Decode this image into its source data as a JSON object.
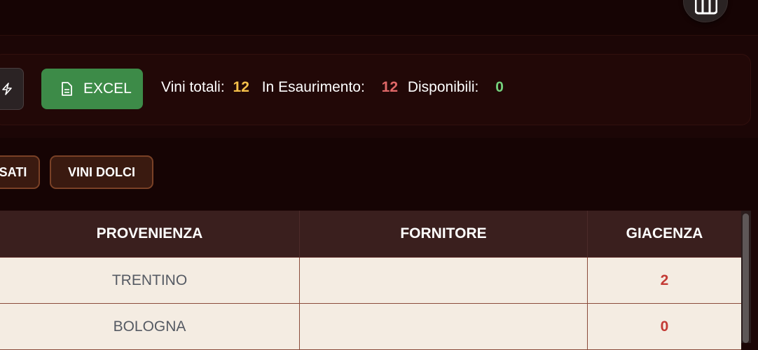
{
  "header": {
    "avatar_icon": "table-grid-icon"
  },
  "toolbar": {
    "icon_button": "bolt-icon",
    "excel_label": "EXCEL",
    "excel_icon": "document-icon",
    "accent_excel": "#3d8b48"
  },
  "stats": {
    "total_label": "Vini totali:",
    "total_value": "12",
    "low_label": "In Esaurimento:",
    "low_value": "12",
    "available_label": "Disponibili:",
    "available_value": "0"
  },
  "filters": [
    {
      "label": "SATI"
    },
    {
      "label": "VINI DOLCI"
    }
  ],
  "table": {
    "headers": [
      "PROVENIENZA",
      "FORNITORE",
      "GIACENZA"
    ],
    "rows": [
      [
        "TRENTINO",
        "",
        "2"
      ],
      [
        "BOLOGNA",
        "",
        "0"
      ]
    ]
  }
}
